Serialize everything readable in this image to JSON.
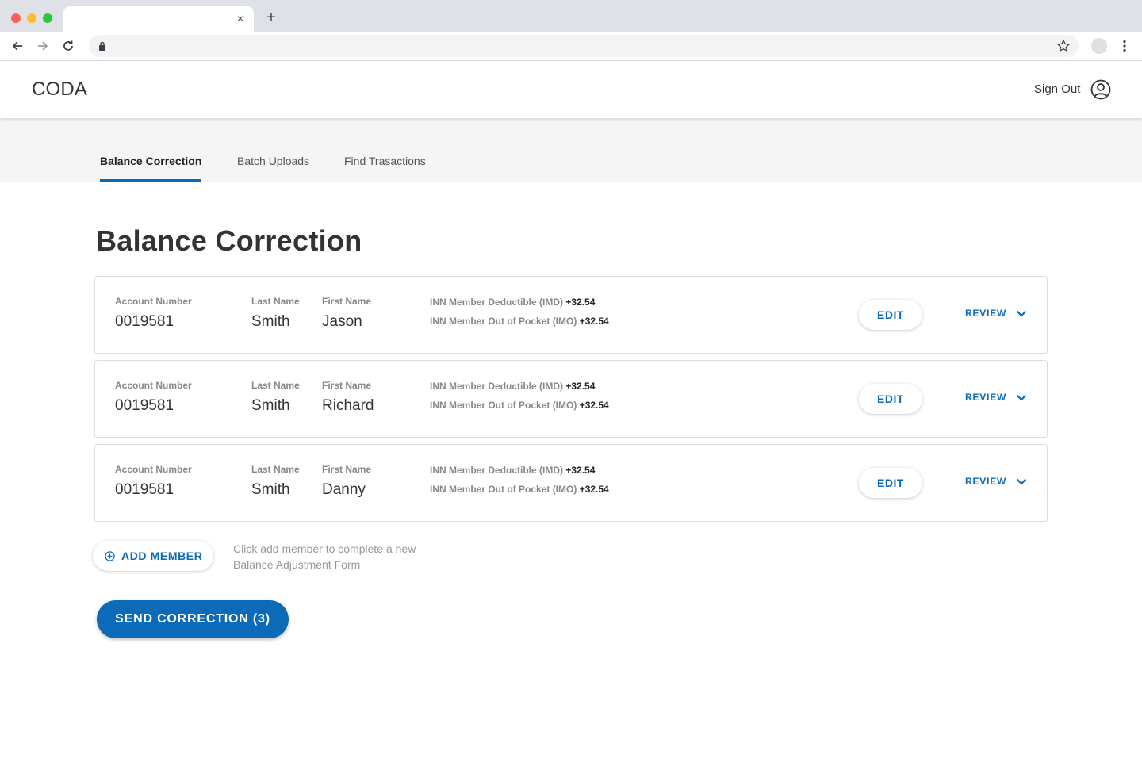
{
  "browser": {
    "tab_close": "×",
    "new_tab": "+"
  },
  "header": {
    "logo": "CODA",
    "sign_out": "Sign Out"
  },
  "nav": {
    "tabs": [
      {
        "label": "Balance Correction",
        "active": true
      },
      {
        "label": "Batch Uploads",
        "active": false
      },
      {
        "label": "Find Trasactions",
        "active": false
      }
    ]
  },
  "main": {
    "title": "Balance Correction",
    "field_labels": {
      "account": "Account Number",
      "last_name": "Last Name",
      "first_name": "First Name"
    },
    "members": [
      {
        "account": "0019581",
        "last_name": "Smith",
        "first_name": "Jason",
        "deductible_label": "INN Member Deductible (IMD)",
        "deductible_value": "+32.54",
        "oop_label": "INN Member Out of Pocket (IMO)",
        "oop_value": "+32.54",
        "edit": "EDIT",
        "review": "REVIEW"
      },
      {
        "account": "0019581",
        "last_name": "Smith",
        "first_name": "Richard",
        "deductible_label": "INN Member Deductible (IMD)",
        "deductible_value": "+32.54",
        "oop_label": "INN Member Out of Pocket (IMO)",
        "oop_value": "+32.54",
        "edit": "EDIT",
        "review": "REVIEW"
      },
      {
        "account": "0019581",
        "last_name": "Smith",
        "first_name": "Danny",
        "deductible_label": "INN Member Deductible (IMD)",
        "deductible_value": "+32.54",
        "oop_label": "INN Member Out of Pocket (IMO)",
        "oop_value": "+32.54",
        "edit": "EDIT",
        "review": "REVIEW"
      }
    ],
    "add_member": "ADD MEMBER",
    "hint": "Click add member to complete a new Balance Adjustment Form",
    "send_button": "SEND CORRECTION (3)"
  },
  "colors": {
    "accent": "#0b6bb8",
    "tabs_bg": "#f5f5f5",
    "card_border": "#dcdcdc"
  }
}
